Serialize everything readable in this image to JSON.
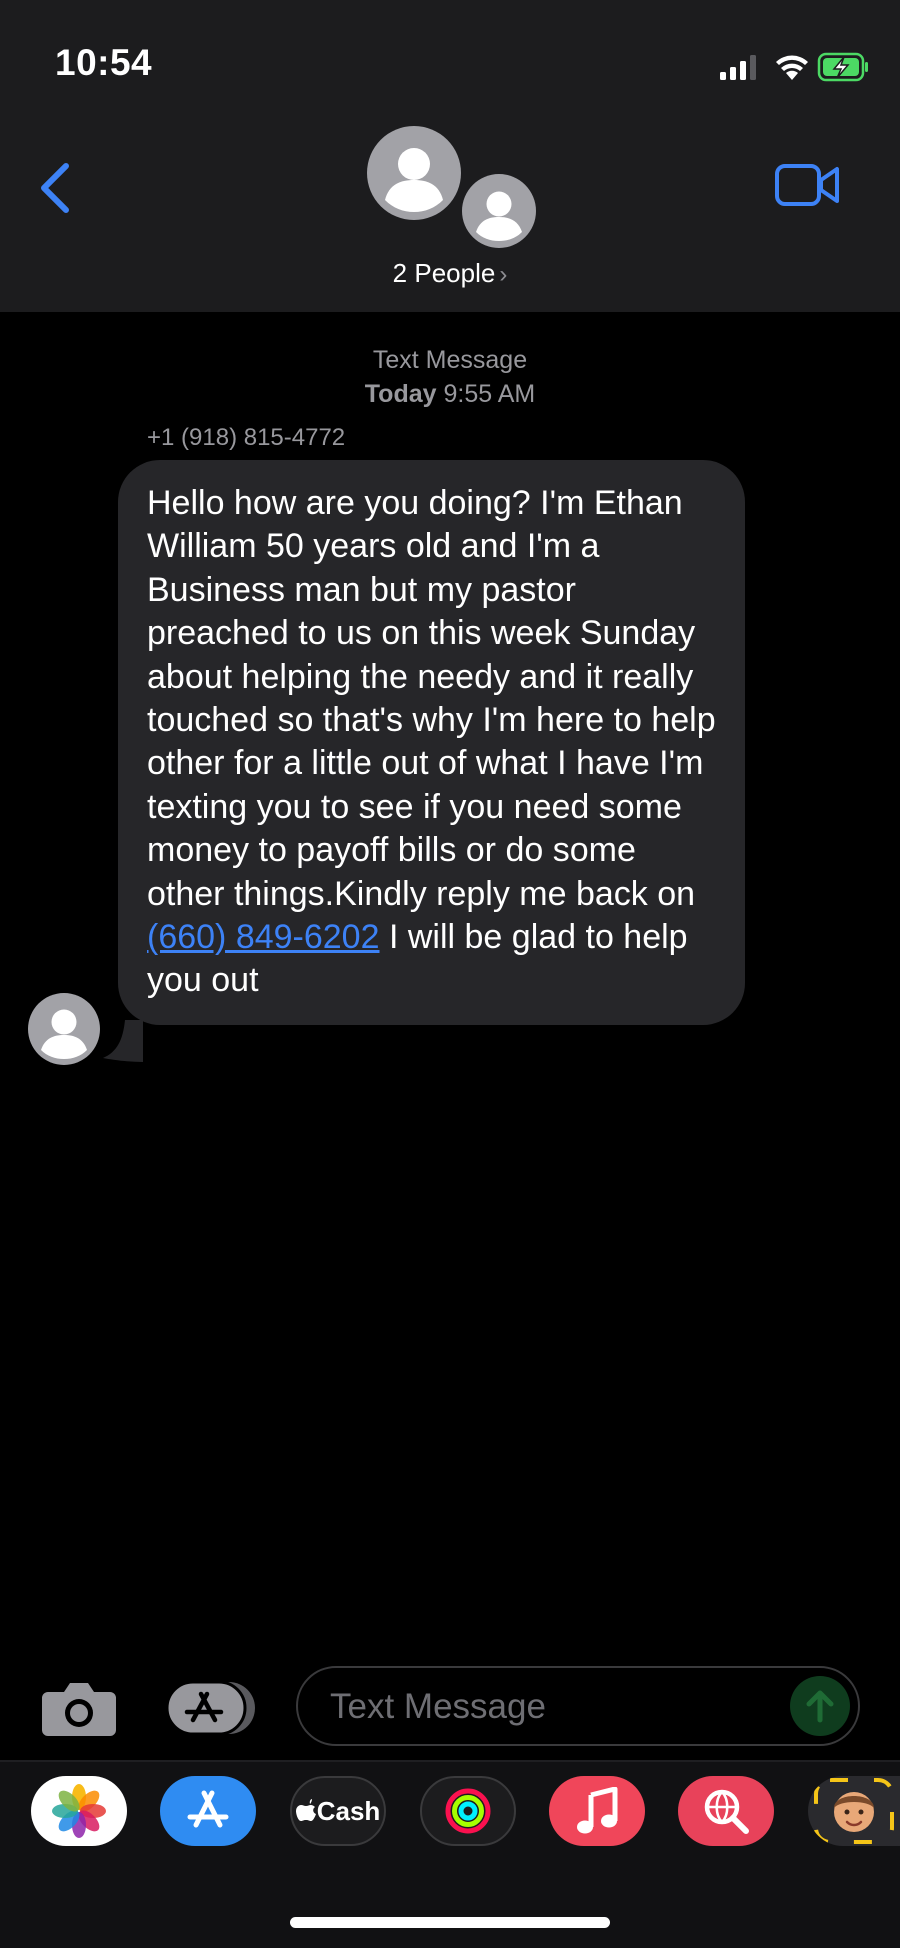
{
  "status_bar": {
    "time": "10:54"
  },
  "header": {
    "group_label": "2 People",
    "group_chevron": "›",
    "back_icon": "chevron-left-icon",
    "video_icon": "video-camera-icon"
  },
  "conversation": {
    "service": "Text Message",
    "date_label": "Today",
    "time_label": "9:55 AM",
    "sender": "+1 (918) 815-4772",
    "message": {
      "text_before_link": "Hello how are you doing? I'm Ethan William 50 years  old and I'm a Business man but my pastor preached to us on this week Sunday about helping the needy and it really touched so that's why I'm here to help other for a little out of what I have I'm texting you to see if you need some money to payoff bills or do some other things.Kindly reply me back on ",
      "link_text": "(660) 849-6202",
      "text_after_link": " I will be glad to help you out"
    }
  },
  "composer": {
    "placeholder": "Text Message",
    "camera_icon": "camera-icon",
    "apps_icon": "app-store-icon",
    "send_icon": "arrow-up-icon"
  },
  "app_strip": {
    "apps": [
      {
        "name": "Photos",
        "icon": "photos-icon"
      },
      {
        "name": "App Store",
        "icon": "app-store-icon"
      },
      {
        "name": "Apple Cash",
        "label": "Cash",
        "icon": "apple-cash-icon"
      },
      {
        "name": "Fitness",
        "icon": "activity-rings-icon"
      },
      {
        "name": "Music",
        "icon": "music-note-icon"
      },
      {
        "name": "Web Search",
        "icon": "web-search-icon"
      },
      {
        "name": "Memoji",
        "icon": "memoji-icon"
      }
    ]
  },
  "colors": {
    "accent_blue": "#3d82f6",
    "header_bg": "#1c1c1e",
    "bubble_bg": "#262629",
    "battery_green": "#4cd964"
  }
}
